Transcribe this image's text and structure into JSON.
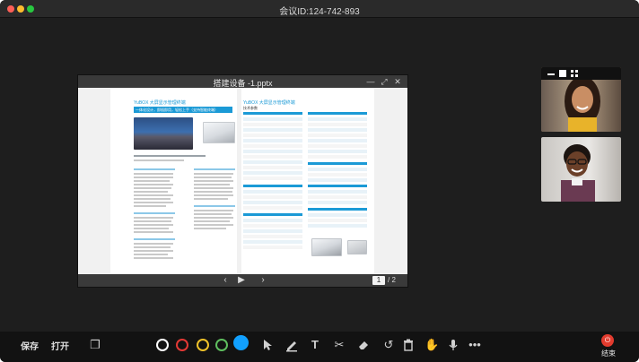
{
  "window": {
    "title": "会议ID:124-742-893"
  },
  "viewer": {
    "title": "搭建设备 -1.pptx",
    "controls": {
      "min": "—",
      "expand": "⤢",
      "close": "✕"
    },
    "footer": {
      "prev": "‹",
      "play": "▶",
      "next": "›",
      "current_page": "1",
      "total_pages": "/ 2"
    },
    "left_page": {
      "title": "YuBOX 大屏显示管理终端",
      "banner": "一体化设计，即插即用，轻松上手（支持智能终端）"
    },
    "right_page": {
      "title": "YuBOX 大屏显示管理终端",
      "subtitle": "技术参数"
    }
  },
  "videos": [
    {
      "name": "participant-1"
    },
    {
      "name": "participant-2"
    }
  ],
  "toolbar": {
    "save": "保存",
    "open": "打开",
    "end": "结束",
    "colors": {
      "white": "#ffffff",
      "red": "#e53935",
      "yellow": "#f0c22a",
      "green": "#5fbf5f",
      "blue": "#11a0ff"
    },
    "icons": [
      "copy-icon",
      "pointer-icon",
      "pen-icon",
      "text-icon",
      "scissors-icon",
      "eraser-icon",
      "undo-icon",
      "trash-icon",
      "hand-icon",
      "microphone-icon",
      "more-icon"
    ]
  }
}
